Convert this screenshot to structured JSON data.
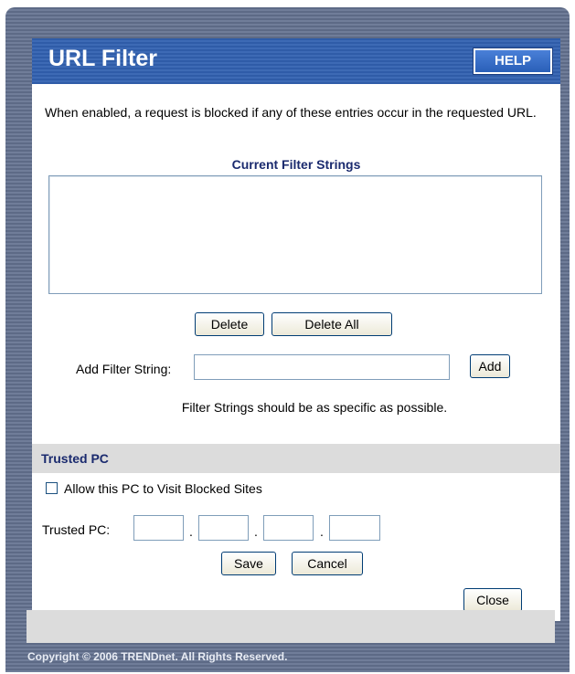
{
  "header": {
    "title": "URL Filter",
    "help_label": "HELP"
  },
  "main": {
    "description": "When enabled, a request is blocked if any of these entries occur in the requested URL.",
    "list_heading": "Current Filter Strings",
    "delete_label": "Delete",
    "delete_all_label": "Delete All",
    "add_filter_label": "Add Filter String:",
    "add_filter_value": "",
    "add_label": "Add",
    "hint": "Filter Strings should be as specific as possible."
  },
  "trusted": {
    "section_title": "Trusted PC",
    "allow_label": "Allow this PC to Visit Blocked Sites",
    "allow_checked": false,
    "trusted_pc_label": "Trusted PC:",
    "octets": [
      "",
      "",
      "",
      ""
    ],
    "dot": ".",
    "save_label": "Save",
    "cancel_label": "Cancel",
    "close_label": "Close"
  },
  "footer": {
    "copyright": "Copyright © 2006 TRENDnet. All Rights Reserved."
  },
  "colors": {
    "title_blue": "#3d6ab5",
    "frame_gray": "#6a7792",
    "heading_navy": "#1a2a6e",
    "section_gray": "#dcdcdc"
  }
}
